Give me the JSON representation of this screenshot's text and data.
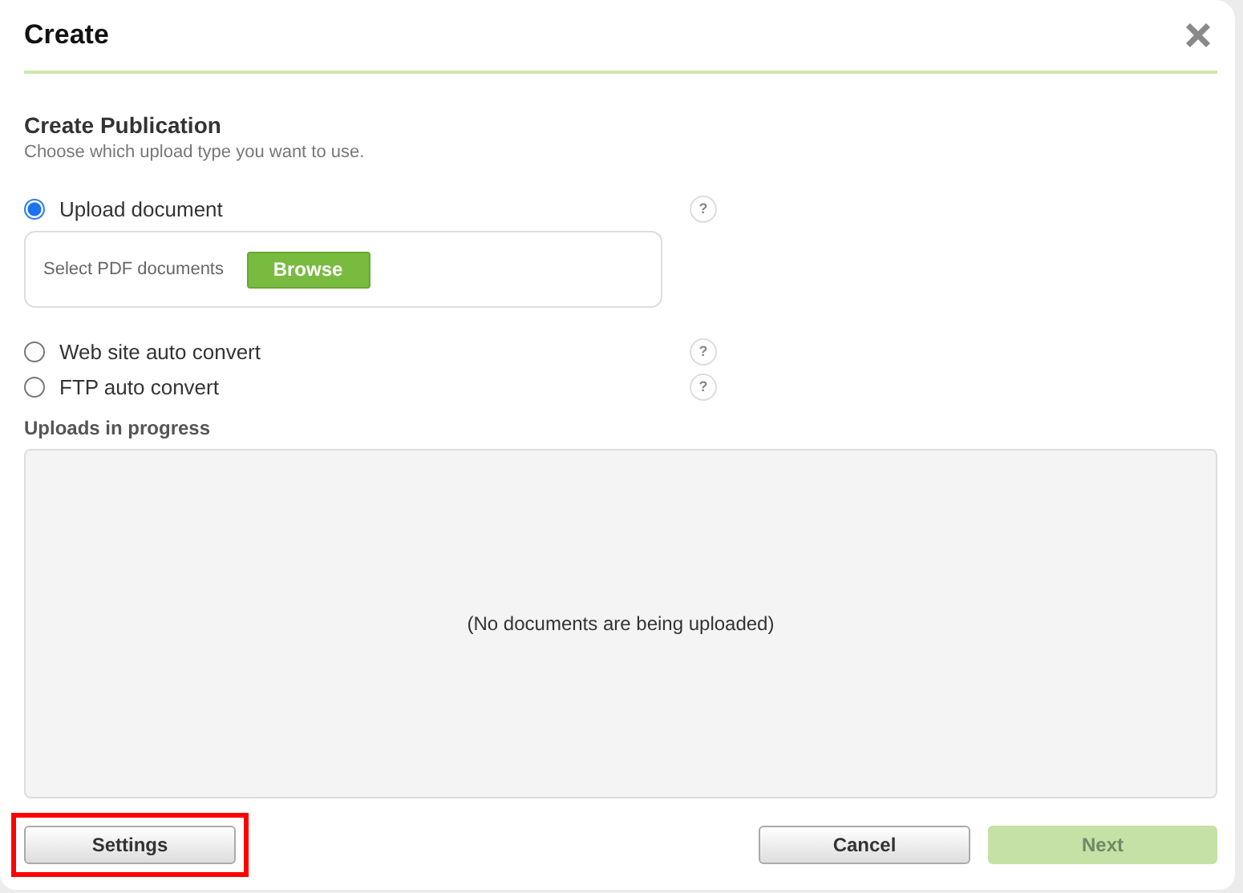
{
  "dialog": {
    "title": "Create"
  },
  "section": {
    "heading": "Create Publication",
    "description": "Choose which upload type you want to use."
  },
  "options": [
    {
      "label": "Upload document",
      "selected": true,
      "help": "?",
      "panel": {
        "label": "Select PDF documents",
        "button": "Browse"
      }
    },
    {
      "label": "Web site auto convert",
      "selected": false,
      "help": "?"
    },
    {
      "label": "FTP auto convert",
      "selected": false,
      "help": "?"
    }
  ],
  "uploads": {
    "heading": "Uploads in progress",
    "empty_message": "(No documents are being uploaded)"
  },
  "buttons": [
    {
      "label": "Settings",
      "kind": "secondary",
      "disabled": false,
      "highlighted": true
    },
    {
      "label": "Cancel",
      "kind": "secondary",
      "disabled": false,
      "highlighted": false
    },
    {
      "label": "Next",
      "kind": "primary",
      "disabled": true,
      "highlighted": false
    }
  ]
}
